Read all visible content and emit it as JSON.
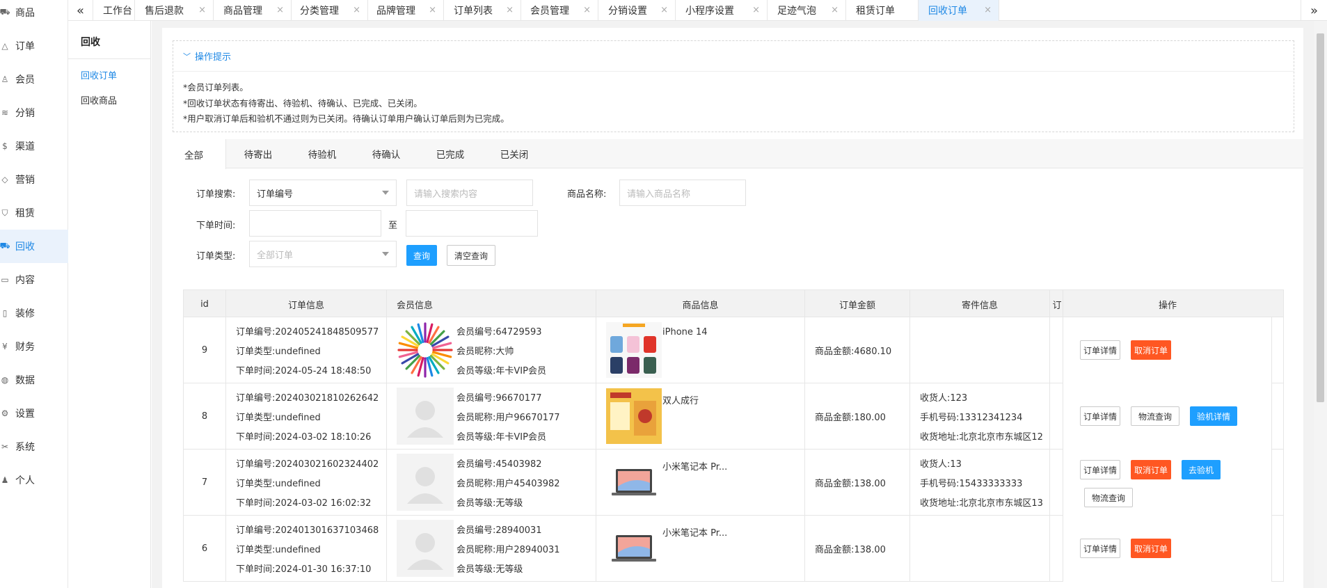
{
  "leftnav": [
    {
      "label": "商品",
      "icon": "cart-icon"
    },
    {
      "label": "订单",
      "icon": "bell-icon"
    },
    {
      "label": "会员",
      "icon": "user-icon"
    },
    {
      "label": "分销",
      "icon": "layers-icon"
    },
    {
      "label": "渠道",
      "icon": "dollar-icon"
    },
    {
      "label": "营销",
      "icon": "diamond-icon"
    },
    {
      "label": "租赁",
      "icon": "shield-icon"
    },
    {
      "label": "回收",
      "icon": "cart-icon"
    },
    {
      "label": "内容",
      "icon": "book-icon"
    },
    {
      "label": "装修",
      "icon": "tablet-icon"
    },
    {
      "label": "财务",
      "icon": "yen-icon"
    },
    {
      "label": "数据",
      "icon": "globe-icon"
    },
    {
      "label": "设置",
      "icon": "gear-icon"
    },
    {
      "label": "系统",
      "icon": "tools-icon"
    },
    {
      "label": "个人",
      "icon": "person-icon"
    }
  ],
  "tabs": [
    {
      "label": "工作台",
      "closable": false
    },
    {
      "label": "售后退款",
      "closable": true
    },
    {
      "label": "商品管理",
      "closable": true
    },
    {
      "label": "分类管理",
      "closable": true
    },
    {
      "label": "品牌管理",
      "closable": true
    },
    {
      "label": "订单列表",
      "closable": true
    },
    {
      "label": "会员管理",
      "closable": true
    },
    {
      "label": "分销设置",
      "closable": true
    },
    {
      "label": "小程序设置",
      "closable": true
    },
    {
      "label": "足迹气泡",
      "closable": true
    },
    {
      "label": "租赁订单",
      "closable": false
    },
    {
      "label": "回收订单",
      "closable": true
    }
  ],
  "tab_close_glyph": "×",
  "subside": {
    "title": "回收",
    "items": [
      "回收订单",
      "回收商品"
    ]
  },
  "tips": {
    "title": "操作提示",
    "lines": [
      "*会员订单列表。",
      "*回收订单状态有待寄出、待验机、待确认、已完成、已关闭。",
      "*用户取消订单后和验机不通过则为已关闭。待确认订单用户确认订单后则为已完成。"
    ]
  },
  "status_tabs": [
    "全部",
    "待寄出",
    "待验机",
    "待确认",
    "已完成",
    "已关闭"
  ],
  "filters": {
    "search_label": "订单搜索:",
    "search_type": "订单编号",
    "search_placeholder": "请输入搜索内容",
    "product_label": "商品名称:",
    "product_placeholder": "请输入商品名称",
    "time_label": "下单时间:",
    "time_sep": "至",
    "type_label": "订单类型:",
    "type_placeholder": "全部订单",
    "query_btn": "查询",
    "clear_btn": "清空查询"
  },
  "table": {
    "headers": [
      "id",
      "订单信息",
      "会员信息",
      "商品信息",
      "订单金额",
      "寄件信息",
      "订",
      "操作"
    ],
    "rows": [
      {
        "id": "9",
        "order_no": "订单编号:202405241848509577",
        "order_type": "订单类型:undefined",
        "order_time": "下单时间:2024-05-24 18:48:50",
        "member_no": "会员编号:64729593",
        "member_nick": "会员昵称:大帅",
        "member_level": "会员等级:年卡VIP会员",
        "avatar": "pinwheel",
        "product_img": "phones",
        "product_name": "iPhone 14",
        "amount": "商品金额:4680.10",
        "ship1": "",
        "ship2": "",
        "ship3": "",
        "ops": [
          "订单详情",
          "取消订单"
        ]
      },
      {
        "id": "8",
        "order_no": "订单编号:202403021810262642",
        "order_type": "订单类型:undefined",
        "order_time": "下单时间:2024-03-02 18:10:26",
        "member_no": "会员编号:96670177",
        "member_nick": "会员昵称:用户96670177",
        "member_level": "会员等级:年卡VIP会员",
        "avatar": "default",
        "product_img": "game",
        "product_name": "双人成行",
        "amount": "商品金额:180.00",
        "ship1": "收货人:123",
        "ship2": "手机号码:13312341234",
        "ship3": "收货地址:北京北京市东城区12",
        "ops": [
          "订单详情",
          "物流查询",
          "验机详情"
        ]
      },
      {
        "id": "7",
        "order_no": "订单编号:202403021602324402",
        "order_type": "订单类型:undefined",
        "order_time": "下单时间:2024-03-02 16:02:32",
        "member_no": "会员编号:45403982",
        "member_nick": "会员昵称:用户45403982",
        "member_level": "会员等级:无等级",
        "avatar": "default",
        "product_img": "laptop",
        "product_name": "小米笔记本 Pr...",
        "amount": "商品金额:138.00",
        "ship1": "收货人:13",
        "ship2": "手机号码:15433333333",
        "ship3": "收货地址:北京北京市东城区13",
        "ops": [
          "订单详情",
          "取消订单",
          "去验机",
          "物流查询"
        ]
      },
      {
        "id": "6",
        "order_no": "订单编号:202401301637103468",
        "order_type": "订单类型:undefined",
        "order_time": "下单时间:2024-01-30 16:37:10",
        "member_no": "会员编号:28940031",
        "member_nick": "会员昵称:用户28940031",
        "member_level": "会员等级:无等级",
        "avatar": "default",
        "product_img": "laptop",
        "product_name": "小米笔记本 Pr...",
        "amount": "商品金额:138.00",
        "ship1": "",
        "ship2": "",
        "ship3": "",
        "ops": [
          "订单详情",
          "取消订单"
        ]
      }
    ]
  },
  "colors": {
    "accent": "#1e88e5",
    "primary_btn": "#1e9fff",
    "danger_btn": "#ff5722"
  }
}
